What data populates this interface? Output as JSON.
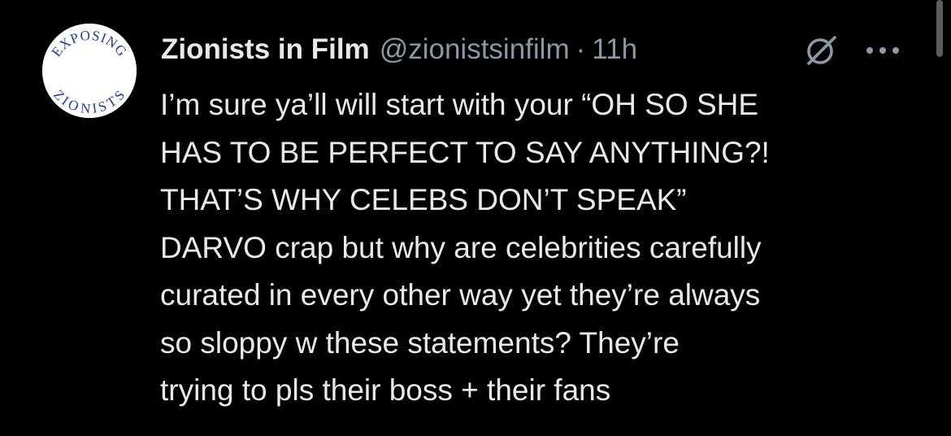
{
  "tweet": {
    "avatar": {
      "top_text": "EXPOSING",
      "bottom_text": "ZIONISTS",
      "text_color": "#1f3aa0"
    },
    "author": {
      "display_name": "Zionists in Film",
      "handle": "@zionistsinfilm",
      "separator": "·",
      "time": "11h"
    },
    "icons": {
      "grok": "grok-icon",
      "more": "more-options-icon"
    },
    "text_lines": [
      "I’m sure ya’ll will start with your “OH SO SHE",
      "HAS TO BE PERFECT TO SAY ANYTHING?!",
      "THAT’S WHY CELEBS DON’T SPEAK”",
      "DARVO crap but why are celebrities carefully",
      "curated in every other way yet they’re always",
      "so sloppy w these statements? They’re",
      "trying to pls their boss + their fans"
    ]
  },
  "colors": {
    "background": "#000000",
    "primary_text": "#e7e9ea",
    "secondary_text": "#8b98a5"
  }
}
